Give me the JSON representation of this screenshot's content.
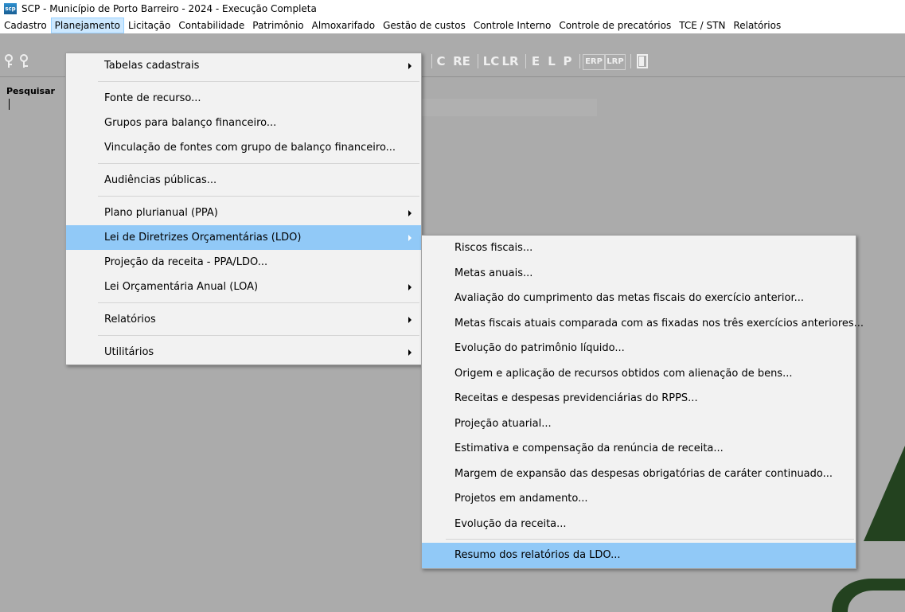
{
  "window": {
    "icon_text": "scp",
    "title": "SCP - Município de Porto Barreiro - 2024 - Execução Completa"
  },
  "menubar": [
    {
      "label": "Cadastro"
    },
    {
      "label": "Planejamento"
    },
    {
      "label": "Licitação"
    },
    {
      "label": "Contabilidade"
    },
    {
      "label": "Patrimônio"
    },
    {
      "label": "Almoxarifado"
    },
    {
      "label": "Gestão de custos"
    },
    {
      "label": "Controle Interno"
    },
    {
      "label": "Controle de precatórios"
    },
    {
      "label": "TCE / STN"
    },
    {
      "label": "Relatórios"
    }
  ],
  "toolbar": {
    "buttons": [
      "C",
      "RE",
      "LC",
      "LR",
      "E",
      "L",
      "P",
      "ERP",
      "LRP"
    ]
  },
  "search": {
    "label": "Pesquisar"
  },
  "planejamento_menu": [
    {
      "label": "Tabelas cadastrais",
      "submenu": true
    },
    {
      "label": "Fonte de recurso..."
    },
    {
      "label": "Grupos para balanço financeiro..."
    },
    {
      "label": "Vinculação de fontes com grupo de balanço financeiro..."
    },
    {
      "label": "Audiências públicas..."
    },
    {
      "label": "Plano plurianual (PPA)",
      "submenu": true
    },
    {
      "label": "Lei de Diretrizes Orçamentárias (LDO)",
      "submenu": true
    },
    {
      "label": "Projeção da receita - PPA/LDO..."
    },
    {
      "label": "Lei Orçamentária Anual (LOA)",
      "submenu": true
    },
    {
      "label": "Relatórios",
      "submenu": true
    },
    {
      "label": "Utilitários",
      "submenu": true
    }
  ],
  "ldo_menu": [
    {
      "label": "Riscos fiscais..."
    },
    {
      "label": "Metas anuais..."
    },
    {
      "label": "Avaliação do cumprimento das metas fiscais do exercício anterior..."
    },
    {
      "label": "Metas fiscais atuais comparada com as fixadas nos três exercícios anteriores..."
    },
    {
      "label": "Evolução do patrimônio líquido..."
    },
    {
      "label": "Origem e aplicação de recursos obtidos com alienação de bens..."
    },
    {
      "label": "Receitas e despesas previdenciárias do RPPS..."
    },
    {
      "label": "Projeção atuarial..."
    },
    {
      "label": "Estimativa e compensação da renúncia de receita..."
    },
    {
      "label": "Margem de expansão das despesas obrigatórias de caráter continuado..."
    },
    {
      "label": "Projetos em andamento..."
    },
    {
      "label": "Evolução da receita..."
    },
    {
      "label": "Resumo dos relatórios da LDO..."
    }
  ]
}
